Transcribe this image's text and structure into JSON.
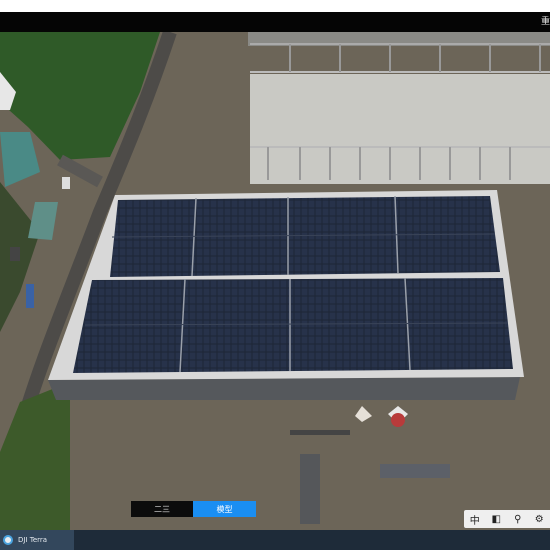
{
  "title_bar": {
    "edge_text": "重"
  },
  "viewport": {
    "content": "aerial-drone-imagery"
  },
  "mode_toggle": {
    "option_2d": "二三",
    "option_3d": "模型",
    "selected": "模型"
  },
  "toolbar": {
    "tool_1": "中",
    "tool_2": "◧",
    "tool_3": "⚲",
    "tool_4": "⚙"
  },
  "taskbar": {
    "app_name": "DJI Terra"
  },
  "colors": {
    "accent": "#1a8ef2",
    "title_bar": "#050505",
    "taskbar": "#1e2b39"
  }
}
